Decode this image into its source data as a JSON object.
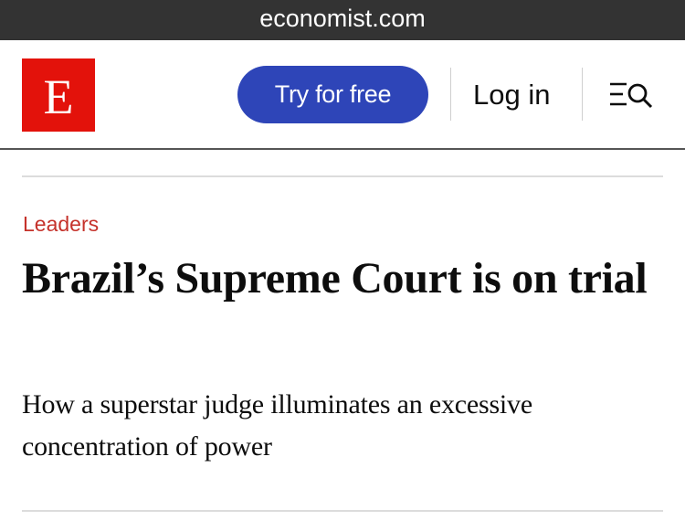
{
  "browser": {
    "url": "economist.com"
  },
  "header": {
    "logo_letter": "E",
    "try_button_label": "Try for free",
    "login_label": "Log in",
    "menu_icon": "menu-search-icon",
    "colors": {
      "brand_red": "#e3120b",
      "button_blue": "#2e45b8"
    }
  },
  "article": {
    "section": "Leaders",
    "headline": "Brazil’s Supreme Court is on trial",
    "subheadline": "How a superstar judge illuminates an excessive concentration of power",
    "section_color": "#c5322b"
  }
}
